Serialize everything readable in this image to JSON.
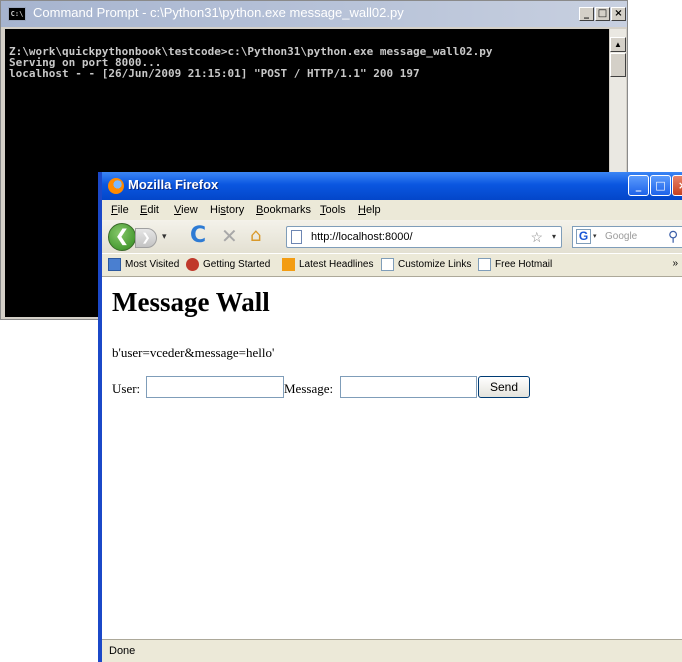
{
  "cmd": {
    "title": "Command Prompt - c:\\Python31\\python.exe message_wall02.py",
    "icon_label": "C:\\",
    "lines": [
      "Z:\\work\\quickpythonbook\\testcode>c:\\Python31\\python.exe message_wall02.py",
      "Serving on port 8000...",
      "localhost - - [26/Jun/2009 21:15:01] \"POST / HTTP/1.1\" 200 197"
    ],
    "controls": {
      "minimize": "_",
      "maximize": "□",
      "close": "×"
    }
  },
  "firefox": {
    "title": "Mozilla Firefox",
    "controls": {
      "minimize": "_",
      "maximize": "□",
      "close": "×"
    },
    "menu": {
      "file": {
        "key": "F",
        "rest": "ile"
      },
      "edit": {
        "key": "E",
        "rest": "dit"
      },
      "view": {
        "key": "V",
        "rest": "iew"
      },
      "history": {
        "pre": "Hi",
        "key": "s",
        "rest": "tory"
      },
      "bookmarks": {
        "key": "B",
        "rest": "ookmarks"
      },
      "tools": {
        "key": "T",
        "rest": "ools"
      },
      "help": {
        "key": "H",
        "rest": "elp"
      }
    },
    "nav": {
      "back": "❮",
      "forward": "❯",
      "dropdown": "▾",
      "reload": "C",
      "stop": "✕",
      "home": "⌂",
      "url": "http://localhost:8000/",
      "star": "☆",
      "search_engine": "G",
      "search_placeholder": "Google",
      "search_go": "⚲"
    },
    "bookmarks": [
      {
        "label": "Most Visited",
        "icon": "most-visited-icon",
        "color": "#4a7fd0"
      },
      {
        "label": "Getting Started",
        "icon": "firefox-icon",
        "color": "#c0392b"
      },
      {
        "label": "Latest Headlines",
        "icon": "rss-icon",
        "color": "#f39c12"
      },
      {
        "label": "Customize Links",
        "icon": "page-icon",
        "color": "#7f9db9"
      },
      {
        "label": "Free Hotmail",
        "icon": "page-icon",
        "color": "#7f9db9"
      }
    ],
    "bookmarks_overflow": "»",
    "page": {
      "heading": "Message Wall",
      "raw_output": "b'user=vceder&message=hello'",
      "user_label": "User:",
      "user_value": "",
      "message_label": "Message:",
      "message_value": "",
      "send_label": "Send"
    },
    "status": "Done"
  }
}
